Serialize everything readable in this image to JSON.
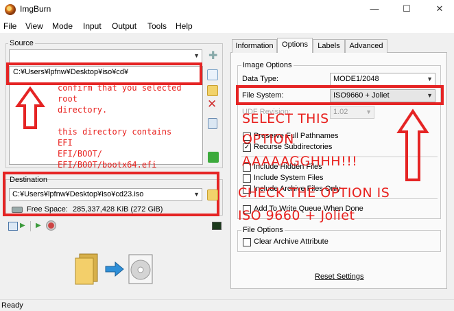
{
  "window": {
    "title": "ImgBurn",
    "min": "—",
    "max": "☐",
    "close": "✕"
  },
  "menu": [
    "File",
    "View",
    "Mode",
    "Input",
    "Output",
    "Tools",
    "Help"
  ],
  "source": {
    "label": "Source",
    "path": "C:¥Users¥lpfnw¥Desktop¥iso¥cd¥",
    "annotation": [
      "confirm that you selected root",
      "directory.",
      "",
      "this directory contains",
      "EFI",
      "EFI/BOOT/",
      "EFI/BOOT/bootx64.efi"
    ]
  },
  "destination": {
    "label": "Destination",
    "path": "C:¥Users¥lpfnw¥Desktop¥iso¥cd23.iso",
    "free_space_label": "Free Space:",
    "free_space_value": "285,337,428 KiB  (272 GiB)"
  },
  "tabs": [
    "Information",
    "Options",
    "Labels",
    "Advanced"
  ],
  "image_options": {
    "group_label": "Image Options",
    "data_type_label": "Data Type:",
    "data_type_value": "MODE1/2048",
    "file_system_label": "File System:",
    "file_system_value": "ISO9660 + Joliet",
    "udf_label": "UDF Revision:",
    "udf_value": "1.02",
    "options": [
      {
        "label": "Preserve Full Pathnames",
        "checked": false
      },
      {
        "label": "Recurse Subdirectories",
        "checked": true
      },
      {
        "label": "Include Hidden Files",
        "checked": false
      },
      {
        "label": "Include System Files",
        "checked": false
      },
      {
        "label": "Include Archive Files Only",
        "checked": false
      },
      {
        "label": "Add To Write Queue When Done",
        "checked": false
      }
    ]
  },
  "file_options": {
    "group_label": "File Options",
    "clear_archive": "Clear Archive Attribute"
  },
  "reset": "Reset Settings",
  "annotations": {
    "select_line1": "SELECT  THIS",
    "select_line2": "OPTION",
    "select_line3": "AAAAAGGHHH!!!",
    "check_line1": "CHECK THE OPTION IS",
    "check_line2": "ISO  9660 + Joliet"
  },
  "status": "Ready",
  "colors": {
    "annotation_red": "#e52424"
  }
}
